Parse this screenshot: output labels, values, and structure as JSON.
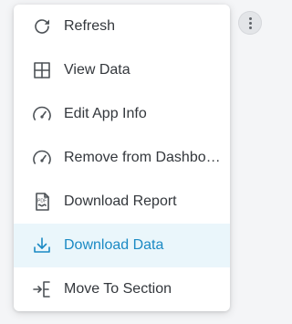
{
  "menu": {
    "items": [
      {
        "label": "Refresh",
        "icon": "refresh-icon",
        "active": false
      },
      {
        "label": "View Data",
        "icon": "table-grid-icon",
        "active": false
      },
      {
        "label": "Edit App Info",
        "icon": "speedometer-icon",
        "active": false
      },
      {
        "label": "Remove from Dashboard",
        "icon": "speedometer-icon",
        "active": false
      },
      {
        "label": "Download Report",
        "icon": "pdf-file-icon",
        "active": false
      },
      {
        "label": "Download Data",
        "icon": "download-icon",
        "active": true
      },
      {
        "label": "Move To Section",
        "icon": "move-to-section-icon",
        "active": false
      }
    ]
  },
  "colors": {
    "accent": "#1b8ac4",
    "active_background": "#eaf6fb",
    "text": "#33373c",
    "icon": "#4d5257"
  }
}
